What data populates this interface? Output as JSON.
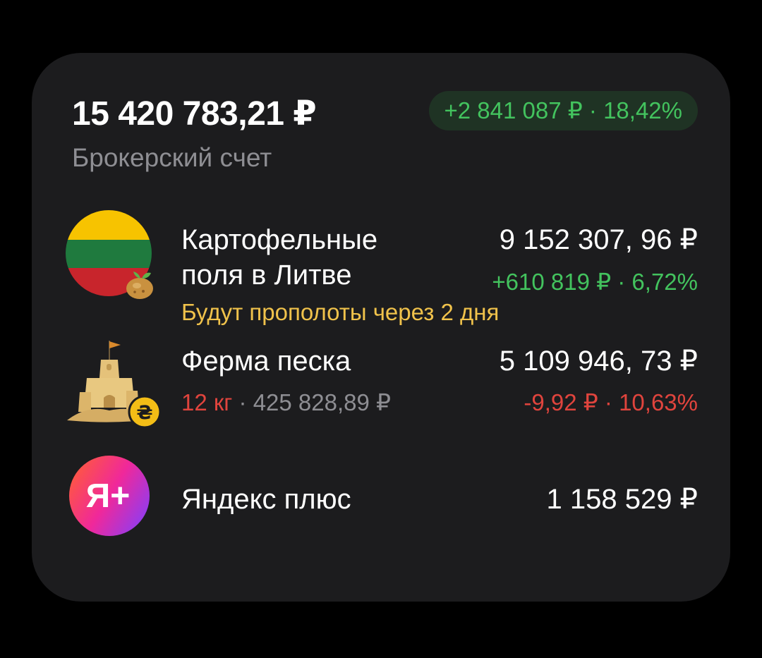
{
  "summary": {
    "total": "15 420 783,21 ₽",
    "gain": "+2 841 087 ₽ · 18,42%",
    "account_label": "Брокерский счет"
  },
  "assets": [
    {
      "icon": "lithuania-flag-icon",
      "name_line1": "Картофельные",
      "name_line2": "поля в Литве",
      "value": "9 152 307, 96 ₽",
      "change": "+610 819 ₽ · 6,72%",
      "note": "Будут прополоты через 2 дня"
    },
    {
      "icon": "sandcastle-icon",
      "name": "Ферма песка",
      "value": "5 109 946, 73 ₽",
      "change": "-9,92 ₽ · 10,63%",
      "quantity": "12 кг",
      "separator": " · ",
      "avg_price": "425 828,89 ₽"
    },
    {
      "icon": "yandex-plus-icon",
      "icon_text": "Я+",
      "name": "Яндекс плюс",
      "value": "1 158 529 ₽"
    }
  ],
  "colors": {
    "positive": "#43c35e",
    "negative": "#e0443d",
    "note": "#f0c24b",
    "muted": "#8e8e93"
  }
}
